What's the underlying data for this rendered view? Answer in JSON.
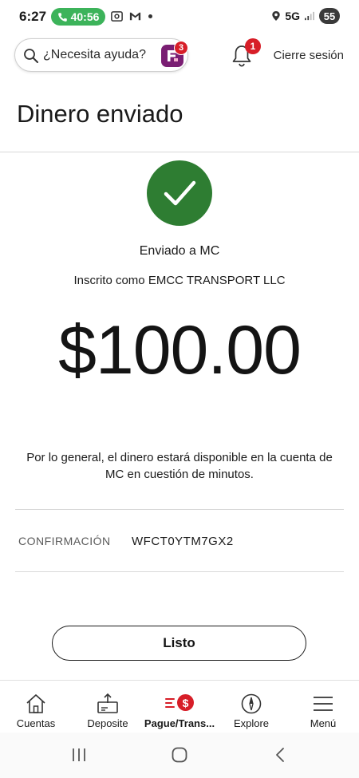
{
  "status_bar": {
    "time": "6:27",
    "call_timer": "40:56",
    "network": "5G",
    "battery": "55"
  },
  "header": {
    "search_placeholder": "¿Necesita ayuda?",
    "assistant_badge": "3",
    "notification_badge": "1",
    "logout_label": "Cierre sesión"
  },
  "page": {
    "title": "Dinero enviado"
  },
  "confirmation": {
    "sent_to": "Enviado a MC",
    "enrolled_as": "Inscrito como EMCC TRANSPORT LLC",
    "amount": "$100.00",
    "availability_note": "Por lo general, el dinero estará disponible en la cuenta de MC en cuestión de minutos.",
    "confirmation_label": "CONFIRMACIÓN",
    "confirmation_code": "WFCT0YTM7GX2",
    "done_label": "Listo"
  },
  "bottom_nav": {
    "items": [
      {
        "label": "Cuentas",
        "icon": "home-icon"
      },
      {
        "label": "Deposite",
        "icon": "deposit-icon"
      },
      {
        "label": "Pague/Trans...",
        "icon": "pay-transfer-icon",
        "badge": "$"
      },
      {
        "label": "Explore",
        "icon": "compass-icon"
      },
      {
        "label": "Menú",
        "icon": "hamburger-menu-icon"
      }
    ]
  },
  "colors": {
    "success_green": "#2e7d32",
    "alert_red": "#d71e28",
    "call_green": "#3cb35a",
    "brand_purple": "#7a1e73"
  }
}
